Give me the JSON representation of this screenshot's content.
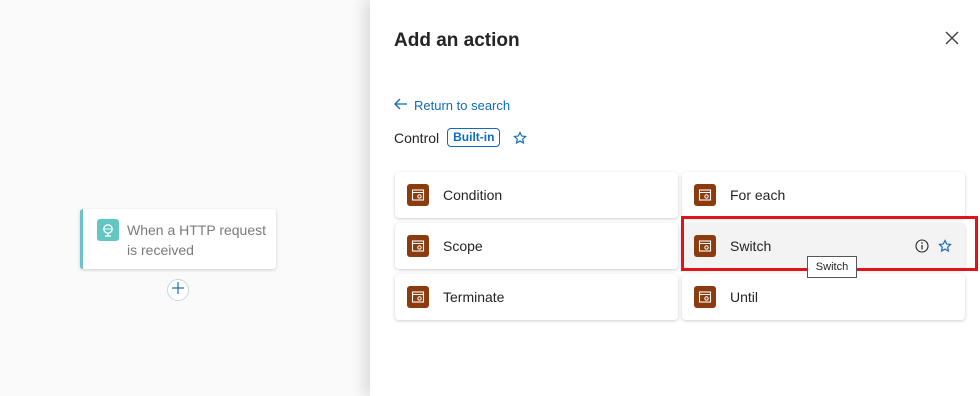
{
  "canvas": {
    "trigger": {
      "title": "When a HTTP request is received",
      "icon": "http-request-icon",
      "accent_color": "#6fc1c8"
    },
    "add_step_icon": "plus-icon"
  },
  "panel": {
    "title": "Add an action",
    "close_icon": "close-icon",
    "return_link": "Return to search",
    "connector": {
      "name": "Control",
      "badge": "Built-in",
      "favorite_icon": "star-icon"
    },
    "actions": [
      {
        "label": "Condition",
        "icon": "control-icon"
      },
      {
        "label": "For each",
        "icon": "control-icon"
      },
      {
        "label": "Scope",
        "icon": "control-icon"
      },
      {
        "label": "Switch",
        "icon": "control-icon",
        "hovered": true
      },
      {
        "label": "Terminate",
        "icon": "control-icon"
      },
      {
        "label": "Until",
        "icon": "control-icon"
      }
    ],
    "tooltip": "Switch",
    "highlighted_action": "Switch"
  },
  "colors": {
    "accent_blue": "#0f6cbd",
    "control_icon": "#8c3b0e",
    "highlight_red": "#e0131b"
  }
}
